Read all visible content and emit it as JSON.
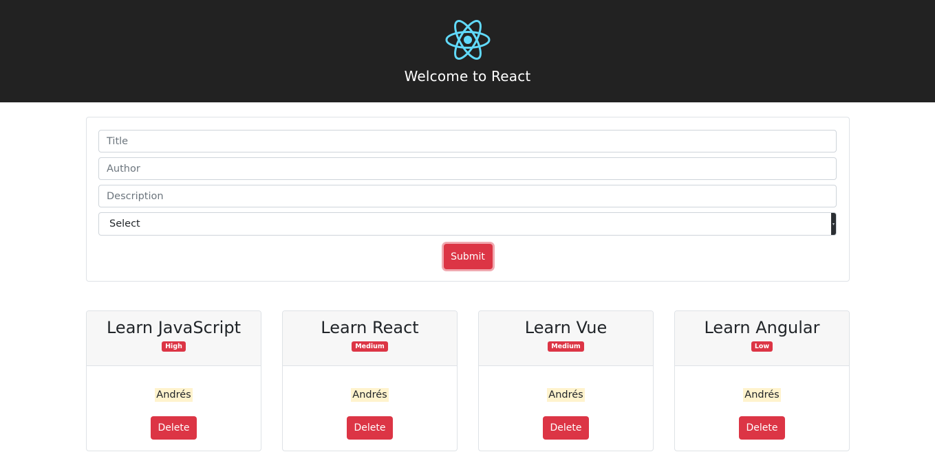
{
  "header": {
    "title": "Welcome to React",
    "logo_icon": "react-logo-icon",
    "logo_color": "#61dafb",
    "background": "#222222"
  },
  "form": {
    "title_placeholder": "Title",
    "author_placeholder": "Author",
    "description_placeholder": "Description",
    "select_value": "Select",
    "submit_label": "Submit"
  },
  "todos": [
    {
      "title": "Learn JavaScript",
      "priority": "High",
      "author": "Andrés",
      "delete_label": "Delete"
    },
    {
      "title": "Learn React",
      "priority": "Medium",
      "author": "Andrés",
      "delete_label": "Delete"
    },
    {
      "title": "Learn Vue",
      "priority": "Medium",
      "author": "Andrés",
      "delete_label": "Delete"
    },
    {
      "title": "Learn Angular",
      "priority": "Low",
      "author": "Andrés",
      "delete_label": "Delete"
    }
  ],
  "colors": {
    "danger": "#dc3545",
    "author_highlight": "#fff3cd"
  }
}
